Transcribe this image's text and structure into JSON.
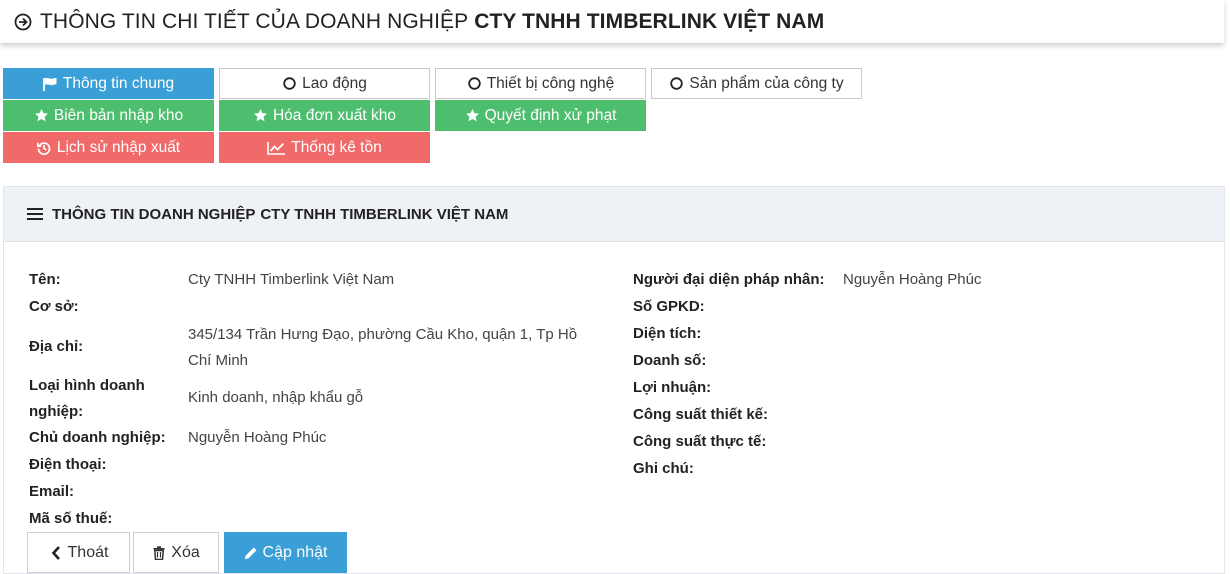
{
  "header": {
    "title_prefix": "THÔNG TIN CHI TIẾT CỦA DOANH NGHIỆP",
    "company": "CTY TNHH TIMBERLINK VIỆT NAM"
  },
  "tabs": [
    {
      "label": "Thông tin chung",
      "icon": "flag-icon",
      "active": true
    },
    {
      "label": "Lao động",
      "icon": "circle-icon"
    },
    {
      "label": "Thiết bị công nghệ",
      "icon": "circle-icon"
    },
    {
      "label": "Sản phẩm của công ty",
      "icon": "circle-icon"
    },
    {
      "label": "Biên bản nhập kho",
      "icon": "star-icon"
    },
    {
      "label": "Hóa đơn xuất kho",
      "icon": "star-icon"
    },
    {
      "label": "Quyết định xử phạt",
      "icon": "star-icon"
    },
    {
      "label": "Lịch sử nhập xuất",
      "icon": "history-icon"
    },
    {
      "label": "Thống kê tồn",
      "icon": "line-chart-icon"
    }
  ],
  "colors": {
    "blue": "#3a9fd6",
    "green": "#4dbd6e",
    "red": "#f06a6a"
  },
  "panel": {
    "title_prefix": "THÔNG TIN DOANH NGHIỆP",
    "company": "CTY TNHH TIMBERLINK VIỆT NAM"
  },
  "info_left": [
    {
      "label": "Tên:",
      "value": "Cty TNHH Timberlink Việt Nam"
    },
    {
      "label": "Cơ sở:",
      "value": ""
    },
    {
      "label": "Địa chỉ:",
      "value": "345/134 Trần Hưng Đạo, phường Cầu Kho, quận 1, Tp Hồ Chí Minh"
    },
    {
      "label": "Loại hình doanh nghiệp:",
      "value": "Kinh doanh, nhập khẩu gỗ"
    },
    {
      "label": "Chủ doanh nghiệp:",
      "value": "Nguyễn Hoàng Phúc"
    },
    {
      "label": "Điện thoại:",
      "value": ""
    },
    {
      "label": "Email:",
      "value": ""
    },
    {
      "label": "Mã số thuế:",
      "value": ""
    }
  ],
  "info_right": [
    {
      "label": "Người đại diện pháp nhân:",
      "value": "Nguyễn Hoàng Phúc"
    },
    {
      "label": "Số GPKD:",
      "value": ""
    },
    {
      "label": "Diện tích:",
      "value": ""
    },
    {
      "label": "Doanh số:",
      "value": ""
    },
    {
      "label": "Lợi nhuận:",
      "value": ""
    },
    {
      "label": "Công suất thiết kế:",
      "value": ""
    },
    {
      "label": "Công suất thực tế:",
      "value": ""
    },
    {
      "label": "Ghi chú:",
      "value": ""
    }
  ],
  "actions": {
    "exit": "Thoát",
    "delete": "Xóa",
    "update": "Cập nhật"
  }
}
